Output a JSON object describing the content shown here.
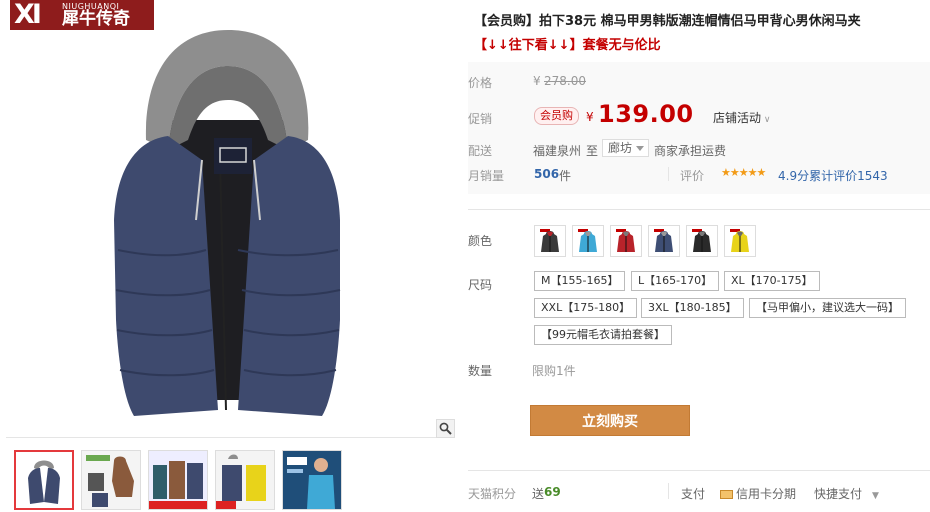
{
  "brand": {
    "logo_letters": "XI",
    "logo_en": "NIUGHUANQI",
    "logo_cn": "犀牛传奇"
  },
  "product": {
    "title": "【会员购】拍下38元 棉马甲男韩版潮连帽情侣马甲背心男休闲马夹",
    "subtitle": "【↓↓往下看↓↓】套餐无与伦比"
  },
  "price": {
    "label": "价格",
    "original_currency": "¥",
    "original_value": "278.00",
    "promo_label": "促销",
    "member_badge": "会员购",
    "promo_currency": "¥",
    "promo_value": "139.00",
    "shop_activity": "店铺活动"
  },
  "shipping": {
    "label": "配送",
    "from": "福建泉州",
    "to_word": "至",
    "destination": "廊坊",
    "fee": "商家承担运费"
  },
  "sales": {
    "label": "月销量",
    "count": "506",
    "unit": "件",
    "review_label": "评价",
    "stars": "★★★★★",
    "score": "4.9分",
    "review_text": "累计评价1543"
  },
  "color": {
    "label": "颜色",
    "options": [
      {
        "name": "black-red",
        "body": "#3a3a3a",
        "accent": "#b8232a"
      },
      {
        "name": "sky-blue",
        "body": "#3fa9d6",
        "accent": "#9a9a9a"
      },
      {
        "name": "red",
        "body": "#b8232a",
        "accent": "#7a7a7a"
      },
      {
        "name": "navy",
        "body": "#3e4e74",
        "accent": "#9a9a9a"
      },
      {
        "name": "black",
        "body": "#2a2a2a",
        "accent": "#7a7a7a"
      },
      {
        "name": "yellow",
        "body": "#e8d31a",
        "accent": "#6a6a6a"
      }
    ]
  },
  "size": {
    "label": "尺码",
    "options": [
      "M【155-165】",
      "L【165-170】",
      "XL【170-175】",
      "XXL【175-180】",
      "3XL【180-185】",
      "【马甲偏小，建议选大一码】",
      "【99元帽毛衣请拍套餐】"
    ]
  },
  "quantity": {
    "label": "数量",
    "value": "限购1件"
  },
  "buy_button": "立刻购买",
  "footer": {
    "points_label": "天猫积分",
    "points_prefix": "送",
    "points_value": "69",
    "pay_label": "支付",
    "credit_card": "信用卡分期",
    "quick_pay": "快捷支付"
  },
  "colors": {
    "accent_red": "#c40000",
    "buy_button": "#d28a44",
    "brand_red": "#8e1c1c",
    "vest_navy": "#3e4a6e",
    "hood_gray": "#8e8e8e"
  }
}
